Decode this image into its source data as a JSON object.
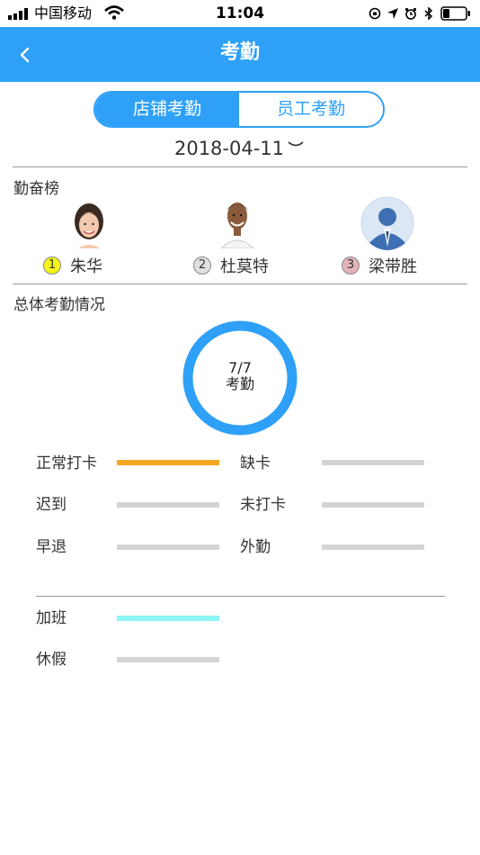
{
  "status_bar": {
    "carrier": "中国移动",
    "time": "11:04"
  },
  "nav": {
    "title": "考勤",
    "back_icon": "chevron-left-icon"
  },
  "tabs": [
    {
      "label": "店铺考勤",
      "active": true
    },
    {
      "label": "员工考勤",
      "active": false
    }
  ],
  "date": "2018-04-11",
  "ranking": {
    "title": "勤奋榜",
    "items": [
      {
        "rank": "1",
        "name": "朱华",
        "badge_color": "#f5f51a"
      },
      {
        "rank": "2",
        "name": "杜莫特",
        "badge_color": "#e0e0e0"
      },
      {
        "rank": "3",
        "name": "梁带胜",
        "badge_color": "#e3b3b8"
      }
    ]
  },
  "overall": {
    "title": "总体考勤情况",
    "ratio": "7/7",
    "label": "考勤",
    "ring_color": "#2ea0f7"
  },
  "stats": [
    {
      "label": "正常打卡",
      "fill": 1.0,
      "color": "#f5a623"
    },
    {
      "label": "缺卡",
      "fill": 0,
      "color": "#d4d4d4"
    },
    {
      "label": "迟到",
      "fill": 0,
      "color": "#d4d4d4"
    },
    {
      "label": "未打卡",
      "fill": 0,
      "color": "#d4d4d4"
    },
    {
      "label": "早退",
      "fill": 0,
      "color": "#d4d4d4"
    },
    {
      "label": "外勤",
      "fill": 0,
      "color": "#d4d4d4"
    }
  ],
  "extra_stats": [
    {
      "label": "加班",
      "fill": 1.0,
      "color": "#8ef5f5"
    },
    {
      "label": "休假",
      "fill": 0,
      "color": "#d4d4d4"
    }
  ]
}
